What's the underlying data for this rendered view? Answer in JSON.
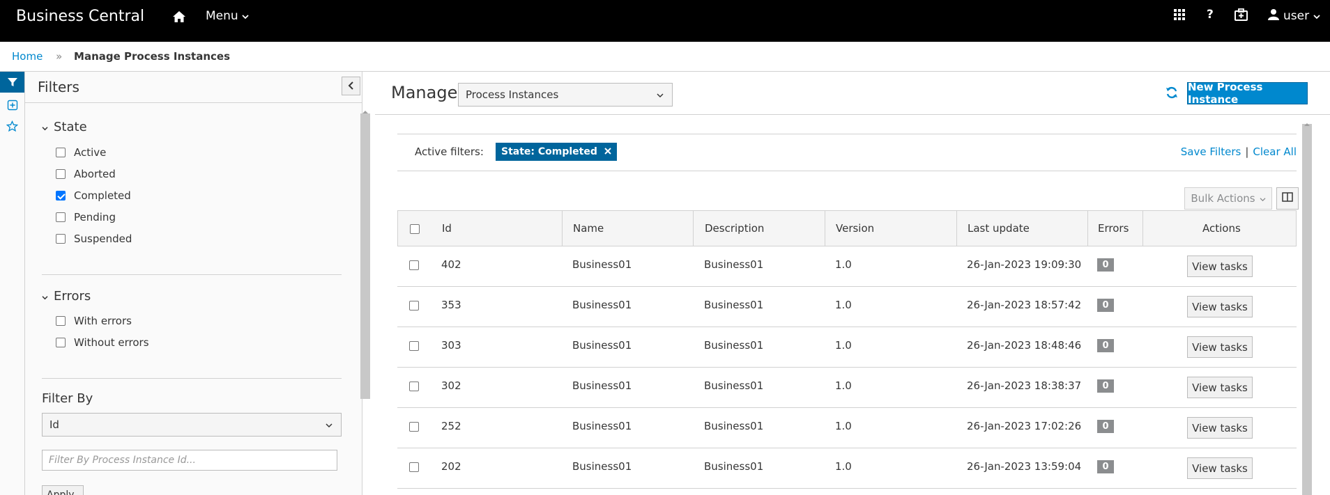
{
  "navbar": {
    "brand": "Business Central",
    "menu_label": "Menu",
    "user_label": "user",
    "icons": [
      "home-icon",
      "apps-grid-icon",
      "help-icon",
      "briefcase-icon",
      "user-icon"
    ]
  },
  "breadcrumb": {
    "home": "Home",
    "current": "Manage Process Instances"
  },
  "filters": {
    "title": "Filters",
    "state": {
      "title": "State",
      "options": [
        {
          "label": "Active",
          "checked": false
        },
        {
          "label": "Aborted",
          "checked": false
        },
        {
          "label": "Completed",
          "checked": true
        },
        {
          "label": "Pending",
          "checked": false
        },
        {
          "label": "Suspended",
          "checked": false
        }
      ]
    },
    "errors": {
      "title": "Errors",
      "options": [
        {
          "label": "With errors",
          "checked": false
        },
        {
          "label": "Without errors",
          "checked": false
        }
      ]
    },
    "filter_by": {
      "title": "Filter By",
      "selected": "Id",
      "placeholder": "Filter By Process Instance Id...",
      "apply_label": "Apply"
    }
  },
  "main": {
    "title": "Manage",
    "view_select": "Process Instances",
    "new_button": "New Process Instance",
    "active_filters_label": "Active filters:",
    "active_filter_chip": "State: Completed",
    "save_filters": "Save Filters",
    "clear_all": "Clear All",
    "bulk_actions": "Bulk Actions",
    "table": {
      "headers": [
        "Id",
        "Name",
        "Description",
        "Version",
        "Last update",
        "Errors",
        "Actions"
      ],
      "action_label": "View tasks",
      "rows": [
        {
          "id": "402",
          "name": "Business01",
          "description": "Business01",
          "version": "1.0",
          "last_update": "26-Jan-2023 19:09:30",
          "errors": "0"
        },
        {
          "id": "353",
          "name": "Business01",
          "description": "Business01",
          "version": "1.0",
          "last_update": "26-Jan-2023 18:57:42",
          "errors": "0"
        },
        {
          "id": "303",
          "name": "Business01",
          "description": "Business01",
          "version": "1.0",
          "last_update": "26-Jan-2023 18:48:46",
          "errors": "0"
        },
        {
          "id": "302",
          "name": "Business01",
          "description": "Business01",
          "version": "1.0",
          "last_update": "26-Jan-2023 18:38:37",
          "errors": "0"
        },
        {
          "id": "252",
          "name": "Business01",
          "description": "Business01",
          "version": "1.0",
          "last_update": "26-Jan-2023 17:02:26",
          "errors": "0"
        },
        {
          "id": "202",
          "name": "Business01",
          "description": "Business01",
          "version": "1.0",
          "last_update": "26-Jan-2023 13:59:04",
          "errors": "0"
        }
      ]
    }
  },
  "colors": {
    "navbar_bg": "#000000",
    "primary": "#0088ce",
    "primary_dark": "#00659c",
    "badge_gray": "#8b8d8f"
  }
}
